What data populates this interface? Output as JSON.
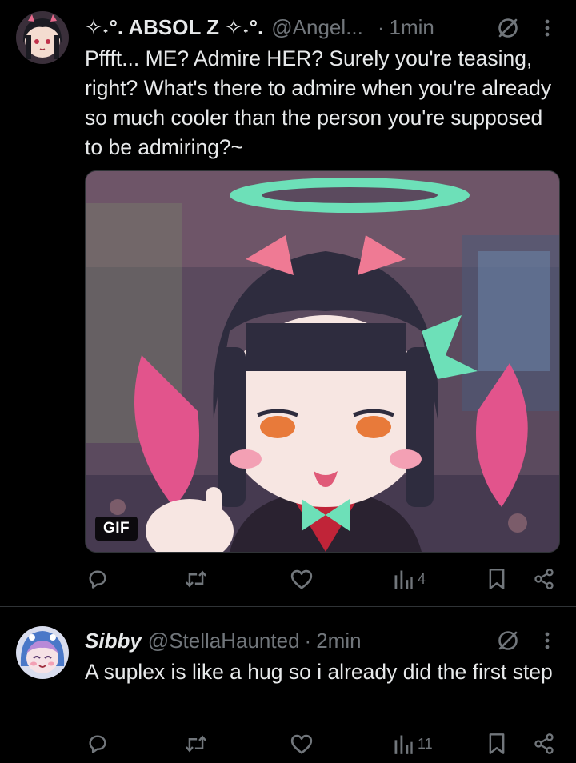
{
  "posts": [
    {
      "author": {
        "display_name": "✧˖°. ABSOL Z ✧˖°.",
        "handle": "@Angel...",
        "avatar_icon": "avatar-dark-hair-girl"
      },
      "separator": "·",
      "time": "1min",
      "text": "Pffft... ME? Admire HER? Surely you're teasing, right? What's there to admire when you're already so much cooler than the person you're supposed to be admiring?~",
      "media": {
        "type": "gif",
        "badge": "GIF",
        "description_icon": "anime-girl-halo-gif"
      },
      "actions": {
        "reply": {
          "icon": "reply-icon",
          "count": ""
        },
        "repost": {
          "icon": "repost-icon",
          "count": ""
        },
        "like": {
          "icon": "heart-icon",
          "count": ""
        },
        "views": {
          "icon": "views-icon",
          "count": "4"
        },
        "bookmark": {
          "icon": "bookmark-icon"
        },
        "share": {
          "icon": "share-icon"
        }
      }
    },
    {
      "author": {
        "display_name": "Sibby",
        "handle": "@StellaHaunted",
        "avatar_icon": "avatar-blue-hood-girl"
      },
      "separator": "·",
      "time": "2min",
      "text": "A suplex is like a hug so i already did the first step",
      "actions": {
        "reply": {
          "icon": "reply-icon",
          "count": ""
        },
        "repost": {
          "icon": "repost-icon",
          "count": ""
        },
        "like": {
          "icon": "heart-icon",
          "count": ""
        },
        "views": {
          "icon": "views-icon",
          "count": "11"
        },
        "bookmark": {
          "icon": "bookmark-icon"
        },
        "share": {
          "icon": "share-icon"
        }
      }
    }
  ],
  "colors": {
    "background": "#000000",
    "text_primary": "#e7e9ea",
    "text_secondary": "#71767b",
    "divider": "#2f3336"
  }
}
